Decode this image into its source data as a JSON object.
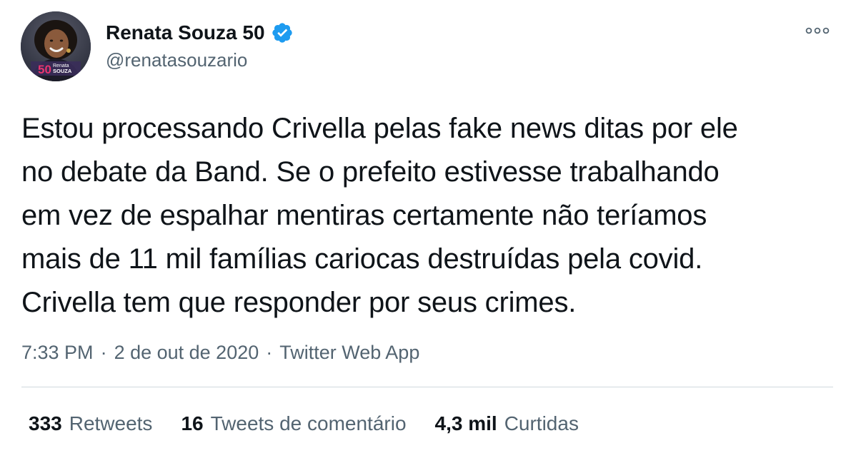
{
  "author": {
    "display_name": "Renata Souza 50",
    "handle": "@renatasouzario",
    "verified": true,
    "avatar_badge": {
      "number": "50",
      "line1": "Renata",
      "line2": "SOUZA"
    }
  },
  "tweet": {
    "text": "Estou processando Crivella pelas fake news ditas por ele\nno debate da Band. Se o prefeito estivesse trabalhando\nem vez de espalhar mentiras certamente não teríamos\nmais de 11 mil famílias cariocas destruídas pela covid.\nCrivella tem que responder por seus crimes."
  },
  "meta": {
    "time": "7:33 PM",
    "separator": "·",
    "date": "2 de out de 2020",
    "source": "Twitter Web App"
  },
  "stats": {
    "retweets": {
      "count": "333",
      "label": "Retweets"
    },
    "quote_tweets": {
      "count": "16",
      "label": "Tweets de comentário"
    },
    "likes": {
      "count": "4,3 mil",
      "label": "Curtidas"
    }
  },
  "icons": {
    "verified": "verified-badge-icon",
    "more": "more-options-icon"
  },
  "colors": {
    "verified_blue": "#1d9bf0",
    "secondary_text": "#536471",
    "primary_text": "#0f1419",
    "divider": "#cfd9de",
    "badge_pink": "#e8356f"
  }
}
